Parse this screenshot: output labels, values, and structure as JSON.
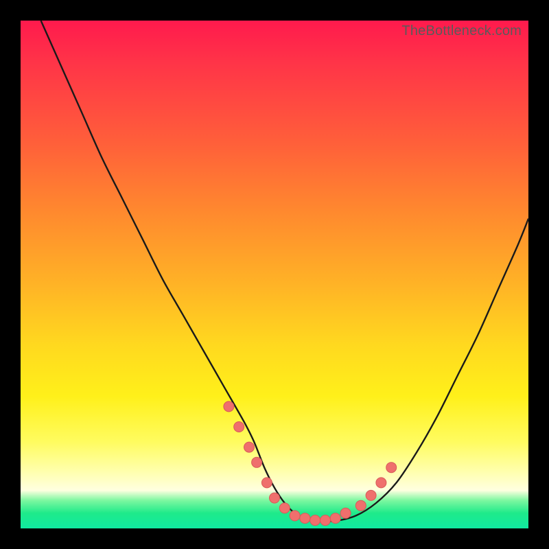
{
  "watermark": "TheBottleneck.com",
  "colors": {
    "frame": "#000000",
    "curve_stroke": "#1a1a1a",
    "marker_fill": "#ef6f6d",
    "marker_stroke": "#d85a58"
  },
  "chart_data": {
    "type": "line",
    "title": "",
    "xlabel": "",
    "ylabel": "",
    "xlim": [
      0,
      100
    ],
    "ylim": [
      0,
      100
    ],
    "grid": false,
    "legend": false,
    "series": [
      {
        "name": "bottleneck-curve",
        "x": [
          4,
          8,
          12,
          16,
          20,
          24,
          28,
          32,
          36,
          40,
          44,
          46,
          48,
          50,
          52,
          54,
          56,
          58,
          62,
          66,
          70,
          74,
          78,
          82,
          86,
          90,
          94,
          98,
          100
        ],
        "y": [
          100,
          91,
          82,
          73,
          65,
          57,
          49,
          42,
          35,
          28,
          21,
          17,
          12,
          8,
          5,
          3,
          2,
          1.5,
          1.5,
          2.5,
          5,
          9,
          15,
          22,
          30,
          38,
          47,
          56,
          61
        ]
      }
    ],
    "markers": {
      "name": "highlight-points",
      "x": [
        41,
        43,
        45,
        46.5,
        48.5,
        50,
        52,
        54,
        56,
        58,
        60,
        62,
        64,
        67,
        69,
        71,
        73
      ],
      "y": [
        24,
        20,
        16,
        13,
        9,
        6,
        4,
        2.5,
        2,
        1.6,
        1.6,
        2,
        3,
        4.5,
        6.5,
        9,
        12
      ]
    }
  }
}
